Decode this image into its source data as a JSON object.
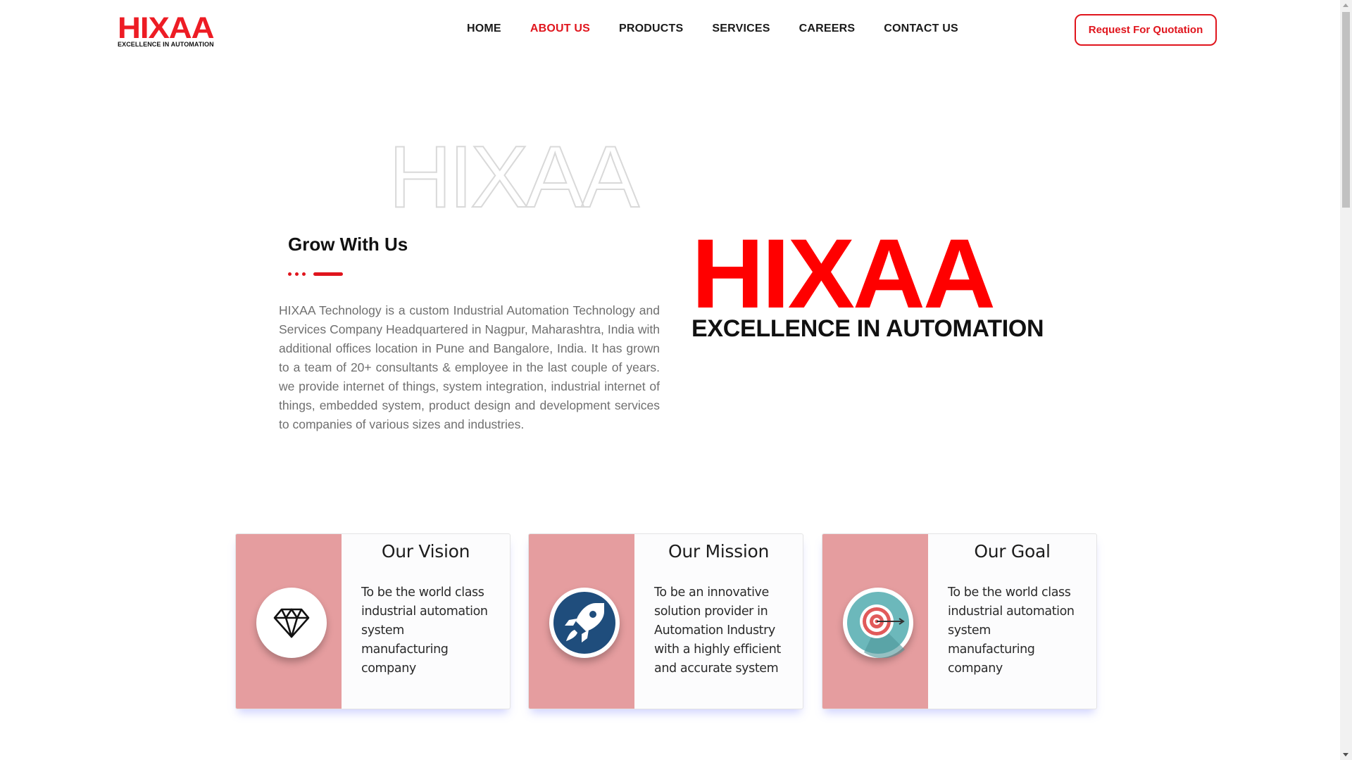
{
  "header": {
    "logo": {
      "word": "HIXAA",
      "tagline": "EXCELLENCE IN AUTOMATION"
    },
    "nav": [
      {
        "label": "HOME",
        "active": false
      },
      {
        "label": "ABOUT US",
        "active": true
      },
      {
        "label": "PRODUCTS",
        "active": false
      },
      {
        "label": "SERVICES",
        "active": false
      },
      {
        "label": "CAREERS",
        "active": false
      },
      {
        "label": "CONTACT US",
        "active": false
      }
    ],
    "quote_button": "Request For Quotation"
  },
  "about": {
    "watermark": "HIXAA",
    "title": "Grow With Us",
    "text": "HIXAA Technology is a custom Industrial Automation Technology and Services Company Headquartered in Nagpur, Maharashtra, India with additional offices location in Pune and Bangalore, India. It has grown to a team of 20+ consultants & employee in the last couple of years. we provide internet of things, system integration, industrial internet of things, embedded system, product design and development services to companies of various sizes and industries.",
    "logo": {
      "word": "HIXAA",
      "tagline": "EXCELLENCE IN AUTOMATION"
    }
  },
  "cards": [
    {
      "title": "Our Vision",
      "text": "To be the world class industrial automation system manufacturing company",
      "icon": "diamond-icon"
    },
    {
      "title": "Our Mission",
      "text": "To be an innovative solution provider in Automation Industry with a highly efficient and accurate system",
      "icon": "rocket-icon"
    },
    {
      "title": "Our Goal",
      "text": "To be the world class industrial automation system manufacturing company",
      "icon": "target-icon"
    }
  ],
  "colors": {
    "brand_red": "#e0151d",
    "logo_red": "#ff0000",
    "card_side": "#e59d9f",
    "mission_icon_bg": "#1f4d7c",
    "goal_icon_bg": "#6cb8bb"
  }
}
